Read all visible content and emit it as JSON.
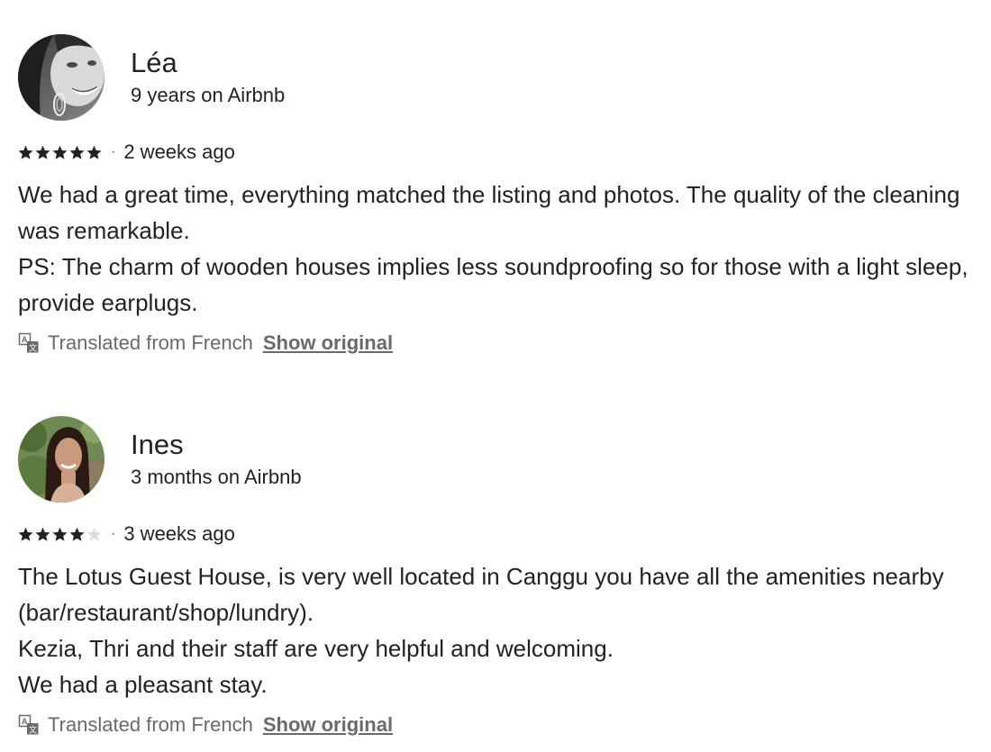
{
  "reviews": [
    {
      "reviewer_name": "Léa",
      "tenure": "9 years on Airbnb",
      "rating": 5,
      "max_rating": 5,
      "separator": "·",
      "date": "2 weeks ago",
      "text": "We had a great time, everything matched the listing and photos. The quality of the cleaning was remarkable.\nPS: The charm of wooden houses implies less soundproofing so for those with a light sleep, provide earplugs.",
      "translated_label": "Translated from French",
      "show_original_label": "Show original",
      "avatar_icon": "avatar-photo-woman-smiling-earring"
    },
    {
      "reviewer_name": "Ines",
      "tenure": "3 months on Airbnb",
      "rating": 4,
      "max_rating": 5,
      "separator": "·",
      "date": "3 weeks ago",
      "text": "The Lotus Guest House, is very well located in Canggu you have all the amenities nearby (bar/restaurant/shop/lundry).\nKezia, Thri and their staff are very helpful and welcoming.\nWe had a pleasant stay.",
      "translated_label": "Translated from French",
      "show_original_label": "Show original",
      "avatar_icon": "avatar-photo-woman-long-dark-hair"
    }
  ],
  "colors": {
    "text_primary": "#222222",
    "text_secondary": "#6a6a6a",
    "star_filled": "#222222",
    "star_empty": "#dddddd"
  }
}
